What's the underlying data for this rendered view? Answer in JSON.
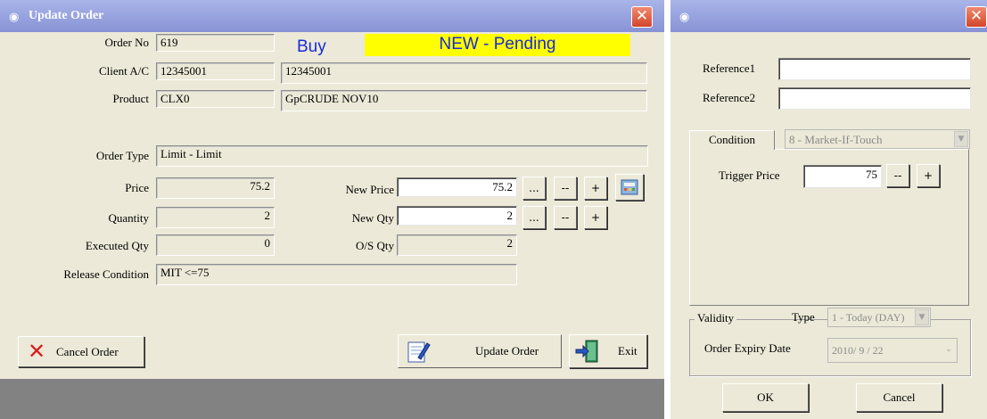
{
  "update_order": {
    "title": "Update Order",
    "labels": {
      "order_no": "Order No",
      "client_ac": "Client A/C",
      "product": "Product",
      "order_type": "Order Type",
      "price": "Price",
      "quantity": "Quantity",
      "executed_qty": "Executed Qty",
      "release_condition": "Release Condition",
      "new_price": "New Price",
      "new_qty": "New Qty",
      "os_qty": "O/S Qty"
    },
    "values": {
      "order_no": "619",
      "side": "Buy",
      "status": "NEW - Pending",
      "client_ac_code": "12345001",
      "client_ac_name": "12345001",
      "product_code": "CLX0",
      "product_name": "GpCRUDE NOV10",
      "order_type": "Limit - Limit",
      "price": "75.2",
      "quantity": "2",
      "executed_qty": "0",
      "release_condition": "MIT <=75",
      "new_price": "75.2",
      "new_qty": "2",
      "os_qty": "2"
    },
    "buttons": {
      "ellipsis": "...",
      "minus": "--",
      "plus": "+",
      "cancel_order": "Cancel Order",
      "update_order": "Update Order",
      "exit": "Exit"
    },
    "colors": {
      "side": "#1a2ad6",
      "status_bg": "#ffff00",
      "status_text": "#1a2ad6"
    }
  },
  "condition_panel": {
    "title": "",
    "labels": {
      "reference1": "Reference1",
      "reference2": "Reference2",
      "trigger_price": "Trigger Price",
      "validity": "Validity",
      "type": "Type",
      "order_expiry_date": "Order Expiry Date"
    },
    "values": {
      "reference1": "",
      "reference2": "",
      "condition_tab": "Condition",
      "condition_select": "8 - Market-If-Touch",
      "trigger_price": "75",
      "validity_type": "1 - Today (DAY)",
      "expiry_date": "2010/  9 / 22"
    },
    "buttons": {
      "minus": "--",
      "plus": "+",
      "ok": "OK",
      "cancel": "Cancel"
    }
  },
  "icons": [
    "app-icon",
    "close-icon",
    "cancel-x-icon",
    "notepad-edit-icon",
    "exit-door-icon",
    "calculator-icon",
    "dropdown-arrow-icon"
  ]
}
